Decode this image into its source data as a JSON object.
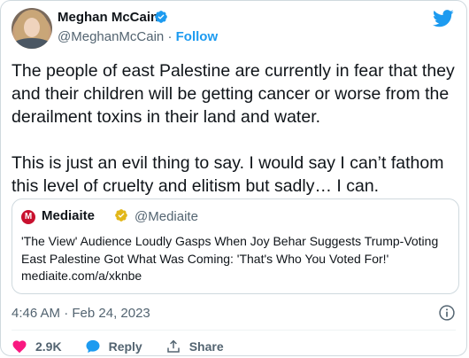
{
  "author": {
    "name": "Meghan McCain",
    "handle": "@MeghanMcCain",
    "separator": "·",
    "follow_label": "Follow"
  },
  "tweet": {
    "text": "The people of east Palestine are currently in fear that they and their children will be getting cancer or worse from the derailment toxins in their land and water.\n\nThis is just an evil thing to say. I would say I can’t fathom this level of cruelty and elitism but sadly… I can.",
    "timestamp": "4:46 AM · Feb 24, 2023"
  },
  "quoted": {
    "name": "Mediaite",
    "handle": "@Mediaite",
    "logo_letter": "M",
    "text": "'The View' Audience Loudly Gasps When Joy Behar Suggests Trump-Voting East Palestine Got What Was Coming: 'That's Who You Voted For!'",
    "link": "mediaite.com/a/xknbe"
  },
  "actions": {
    "like_count": "2.9K",
    "reply_label": "Reply",
    "share_label": "Share"
  },
  "colors": {
    "accent": "#1d9bf0",
    "like": "#f91880",
    "muted": "#536471",
    "mediaite": "#c8102e"
  },
  "icons": [
    "verified-badge-icon",
    "twitter-bird-icon",
    "heart-icon",
    "reply-icon",
    "share-icon",
    "info-icon"
  ]
}
